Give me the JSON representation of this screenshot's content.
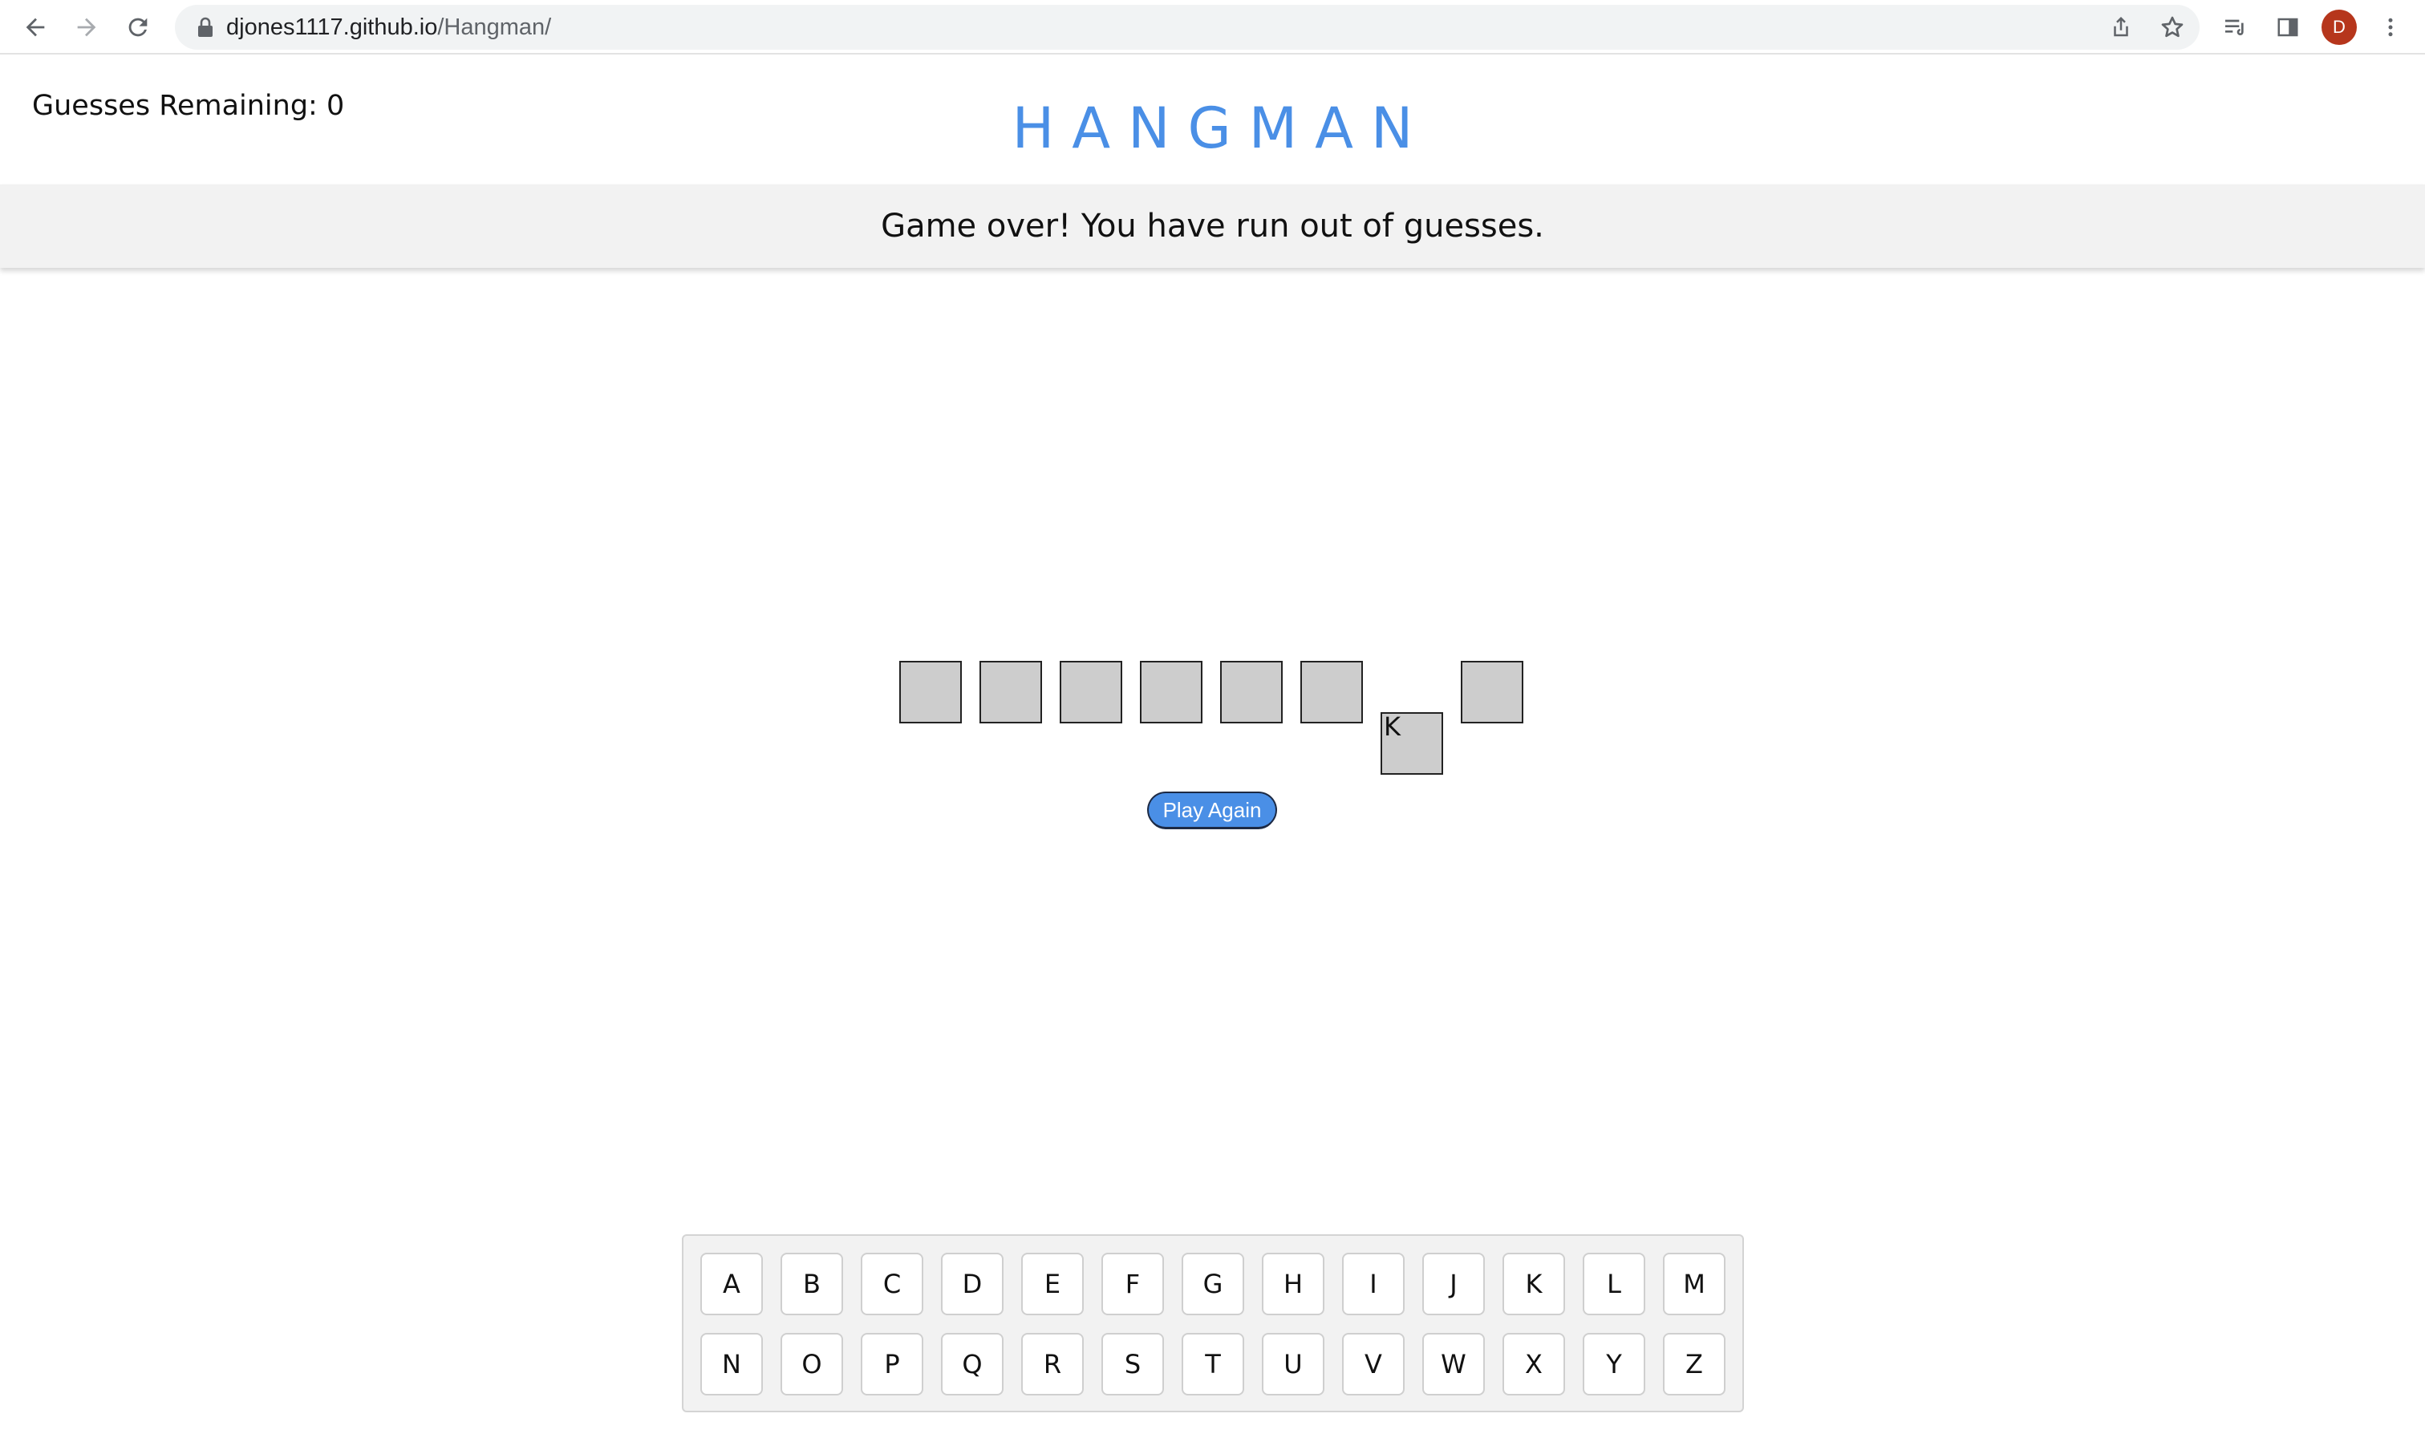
{
  "browser": {
    "url_host": "djones1117.github.io",
    "url_path": "/Hangman/",
    "profile_initial": "D",
    "profile_color": "#b6361c",
    "icons": [
      "back-icon",
      "forward-icon",
      "reload-icon",
      "lock-icon",
      "share-icon",
      "star-icon",
      "reading-list-icon",
      "side-panel-icon",
      "menu-icon"
    ]
  },
  "header": {
    "guesses_remaining": "Guesses Remaining: 0",
    "title": "HANGMAN",
    "title_color": "#4a8fe6"
  },
  "message": "Game over! You have run out of guesses.",
  "word": {
    "tiles": [
      "",
      "",
      "",
      "",
      "",
      "",
      "K",
      ""
    ],
    "tile_color": "#cdcdcd"
  },
  "play_again_label": "Play Again",
  "keyboard": {
    "row1": [
      "A",
      "B",
      "C",
      "D",
      "E",
      "F",
      "G",
      "H",
      "I",
      "J",
      "K",
      "L",
      "M"
    ],
    "row2": [
      "N",
      "O",
      "P",
      "Q",
      "R",
      "S",
      "T",
      "U",
      "V",
      "W",
      "X",
      "Y",
      "Z"
    ]
  }
}
